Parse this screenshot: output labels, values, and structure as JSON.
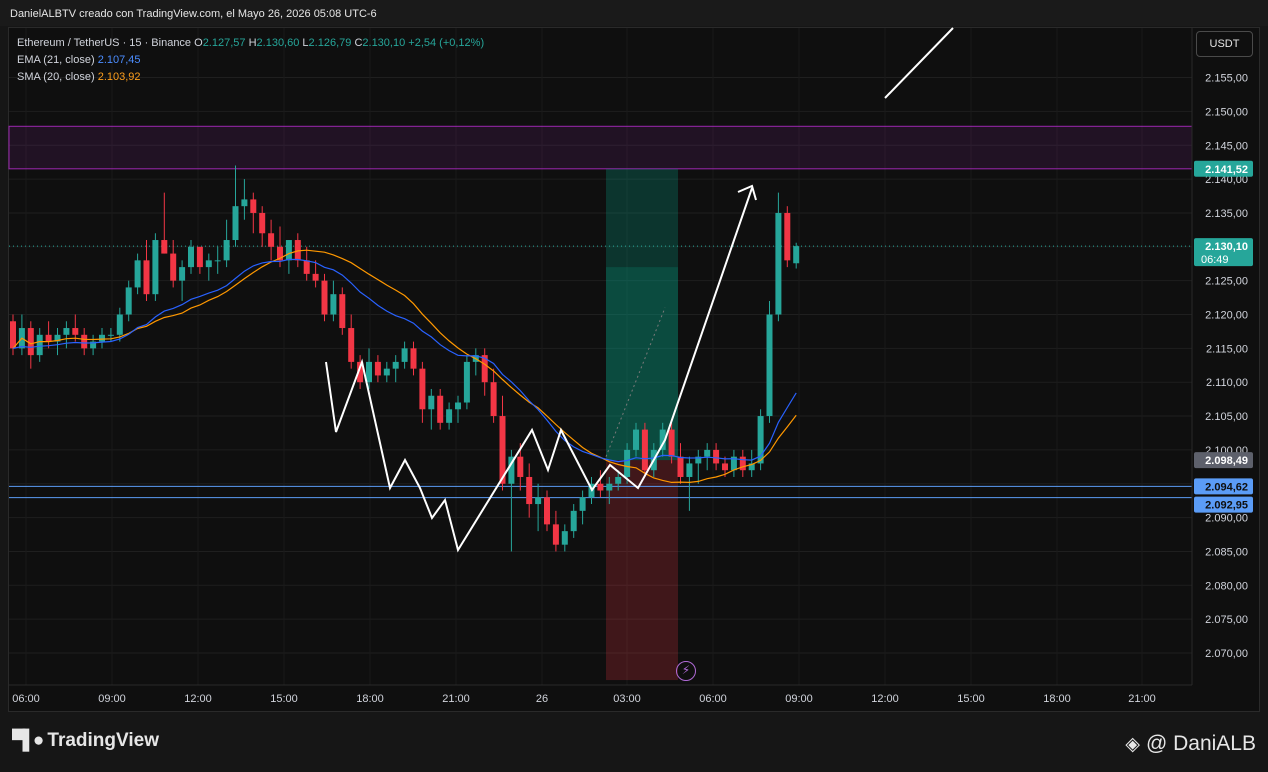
{
  "header": {
    "text": "DanielALBTV creado con TradingView.com, el Mayo 26, 2026 05:08 UTC-6"
  },
  "legend": {
    "symbol": "Ethereum / TetherUS · 15 · Binance",
    "o_label": "O",
    "o_val": "2.127,57",
    "h_label": "H",
    "h_val": "2.130,60",
    "l_label": "L",
    "l_val": "2.126,79",
    "c_label": "C",
    "c_val": "2.130,10",
    "change": "+2,54 (+0,12%)",
    "ema_label": "EMA (21, close)",
    "ema_val": "2.107,45",
    "sma_label": "SMA (20, close)",
    "sma_val": "2.103,92"
  },
  "currency": "USDT",
  "footer": {
    "brand": "TradingView",
    "author": "@ DaniALB"
  },
  "icons": {
    "brand": "tradingview-logo-icon",
    "author": "binance-logo-icon",
    "flash": "lightning-icon"
  },
  "colors": {
    "up": "#26a69a",
    "down": "#f23645",
    "ema": "#2962ff",
    "sma": "#ff9800",
    "zone": "#9c27b0",
    "hline": "#5b9cf6"
  },
  "chart_data": {
    "type": "candlestick",
    "title": "Ethereum / TetherUS · 15 · Binance",
    "ylim": [
      2065,
      2160
    ],
    "y_ticks": [
      "2.070,00",
      "2.075,00",
      "2.080,00",
      "2.085,00",
      "2.090,00",
      "2.095,00",
      "2.100,00",
      "2.105,00",
      "2.110,00",
      "2.115,00",
      "2.120,00",
      "2.125,00",
      "2.130,00",
      "2.135,00",
      "2.140,00",
      "2.145,00",
      "2.150,00",
      "2.155,00"
    ],
    "x_ticks": [
      "06:00",
      "09:00",
      "12:00",
      "15:00",
      "18:00",
      "21:00",
      "26",
      "03:00",
      "06:00",
      "09:00",
      "12:00",
      "15:00",
      "18:00",
      "21:00"
    ],
    "price_labels": [
      {
        "text": "2.141,52",
        "value": 2141.52
      },
      {
        "text": "2.130,10",
        "sub": "06:49",
        "value": 2130.1
      },
      {
        "text": "2.098,49",
        "value": 2098.49
      },
      {
        "text": "2.094,62",
        "value": 2094.62
      },
      {
        "text": "2.092,95",
        "value": 2092.95
      }
    ],
    "last_price": 2130.1,
    "resistance_zone": [
      2141.52,
      2147.8
    ],
    "support_lines": [
      2094.62,
      2092.95
    ],
    "position": {
      "target": 2141.52,
      "entry": 2098.49,
      "stop": 2066
    },
    "series": [
      {
        "name": "EMA (21, close)",
        "value": 2107.45
      },
      {
        "name": "SMA (20, close)",
        "value": 2103.92
      }
    ],
    "candles": [
      [
        2119,
        2120,
        2114,
        2115
      ],
      [
        2115,
        2120,
        2114,
        2118
      ],
      [
        2118,
        2119,
        2112,
        2114
      ],
      [
        2114,
        2118,
        2113,
        2117
      ],
      [
        2117,
        2119,
        2115,
        2116
      ],
      [
        2116,
        2118,
        2114,
        2117
      ],
      [
        2117,
        2119,
        2115,
        2118
      ],
      [
        2118,
        2120,
        2116,
        2117
      ],
      [
        2117,
        2118,
        2114,
        2115
      ],
      [
        2115,
        2117,
        2114,
        2116
      ],
      [
        2116,
        2118,
        2115,
        2117
      ],
      [
        2117,
        2118,
        2116,
        2117
      ],
      [
        2117,
        2121,
        2116,
        2120
      ],
      [
        2120,
        2125,
        2119,
        2124
      ],
      [
        2124,
        2129,
        2123,
        2128
      ],
      [
        2128,
        2131,
        2122,
        2123
      ],
      [
        2123,
        2132,
        2122,
        2131
      ],
      [
        2131,
        2138,
        2129,
        2129
      ],
      [
        2129,
        2131,
        2124,
        2125
      ],
      [
        2125,
        2128,
        2122,
        2127
      ],
      [
        2127,
        2131,
        2126,
        2130
      ],
      [
        2130,
        2127,
        2126,
        2127
      ],
      [
        2127,
        2129,
        2125,
        2128
      ],
      [
        2128,
        2130,
        2126,
        2128
      ],
      [
        2128,
        2134,
        2127,
        2131
      ],
      [
        2131,
        2142,
        2130,
        2136
      ],
      [
        2136,
        2140,
        2134,
        2137
      ],
      [
        2137,
        2138,
        2132,
        2135
      ],
      [
        2135,
        2136,
        2130,
        2132
      ],
      [
        2132,
        2134,
        2128,
        2130
      ],
      [
        2130,
        2133,
        2127,
        2128
      ],
      [
        2128,
        2131,
        2126,
        2131
      ],
      [
        2131,
        2132,
        2127,
        2128
      ],
      [
        2128,
        2130,
        2125,
        2126
      ],
      [
        2126,
        2128,
        2124,
        2125
      ],
      [
        2125,
        2126,
        2119,
        2120
      ],
      [
        2120,
        2125,
        2119,
        2123
      ],
      [
        2123,
        2124,
        2117,
        2118
      ],
      [
        2118,
        2120,
        2112,
        2113
      ],
      [
        2113,
        2114,
        2109,
        2110
      ],
      [
        2110,
        2115,
        2109,
        2113
      ],
      [
        2113,
        2114,
        2110,
        2111
      ],
      [
        2111,
        2113,
        2110,
        2112
      ],
      [
        2112,
        2114,
        2110,
        2113
      ],
      [
        2113,
        2116,
        2112,
        2115
      ],
      [
        2115,
        2116,
        2111,
        2112
      ],
      [
        2112,
        2113,
        2104,
        2106
      ],
      [
        2106,
        2109,
        2103,
        2108
      ],
      [
        2108,
        2109,
        2103,
        2104
      ],
      [
        2104,
        2107,
        2103,
        2106
      ],
      [
        2106,
        2108,
        2104,
        2107
      ],
      [
        2107,
        2114,
        2106,
        2113
      ],
      [
        2113,
        2115,
        2111,
        2114
      ],
      [
        2114,
        2115,
        2108,
        2110
      ],
      [
        2110,
        2112,
        2104,
        2105
      ],
      [
        2105,
        2108,
        2094,
        2095
      ],
      [
        2095,
        2100,
        2085,
        2099
      ],
      [
        2099,
        2101,
        2094,
        2096
      ],
      [
        2096,
        2098,
        2090,
        2092
      ],
      [
        2092,
        2095,
        2088,
        2093
      ],
      [
        2093,
        2094,
        2088,
        2089
      ],
      [
        2089,
        2091,
        2085,
        2086
      ],
      [
        2086,
        2089,
        2085,
        2088
      ],
      [
        2088,
        2092,
        2087,
        2091
      ],
      [
        2091,
        2094,
        2089,
        2093
      ],
      [
        2093,
        2096,
        2092,
        2095
      ],
      [
        2095,
        2097,
        2093,
        2094
      ],
      [
        2094,
        2096,
        2092,
        2095
      ],
      [
        2095,
        2097,
        2094,
        2096
      ],
      [
        2096,
        2101,
        2095,
        2100
      ],
      [
        2100,
        2104,
        2099,
        2103
      ],
      [
        2103,
        2104,
        2096,
        2097
      ],
      [
        2097,
        2101,
        2096,
        2100
      ],
      [
        2100,
        2104,
        2099,
        2103
      ],
      [
        2103,
        2104,
        2098,
        2099
      ],
      [
        2099,
        2101,
        2095,
        2096
      ],
      [
        2096,
        2099,
        2091,
        2098
      ],
      [
        2098,
        2100,
        2095,
        2099
      ],
      [
        2099,
        2101,
        2097,
        2100
      ],
      [
        2100,
        2101,
        2097,
        2098
      ],
      [
        2098,
        2099,
        2096,
        2097
      ],
      [
        2097,
        2100,
        2096,
        2099
      ],
      [
        2099,
        2100,
        2096,
        2097
      ],
      [
        2097,
        2100,
        2096,
        2098
      ],
      [
        2098,
        2106,
        2097,
        2105
      ],
      [
        2105,
        2122,
        2104,
        2120
      ],
      [
        2120,
        2138,
        2119,
        2135
      ],
      [
        2135,
        2136,
        2127,
        2128
      ],
      [
        2127.57,
        2130.6,
        2126.79,
        2130.1
      ]
    ]
  }
}
